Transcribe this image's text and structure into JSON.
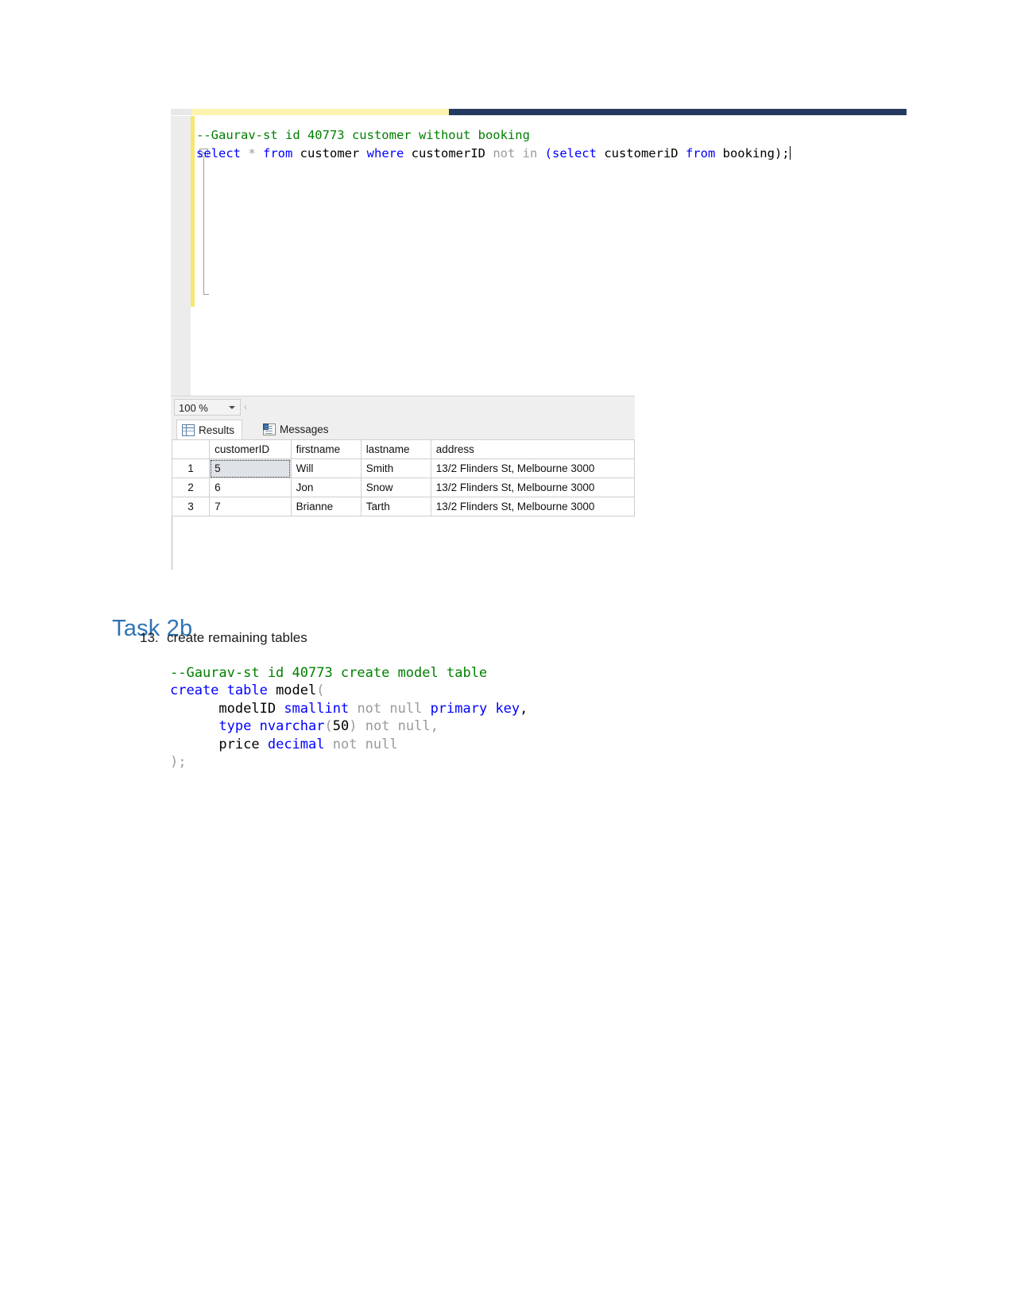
{
  "ssms": {
    "editor": {
      "line1": {
        "comment": "--Gaurav-st id 40773 customer without booking"
      },
      "line2": {
        "kw_select": "select",
        "star": " * ",
        "kw_from": "from",
        "tbl_customer": " customer ",
        "kw_where": "where",
        "col_customerid": " customerID ",
        "kw_not_in": "not in",
        "paren_open": " (",
        "kw_select2": "select",
        "col_customerid2": " customeriD ",
        "kw_from2": "from",
        "tbl_booking": " booking);"
      }
    },
    "zoom": {
      "level": "100 %",
      "splitter_glyph": "‹"
    },
    "tabs": [
      {
        "label": "Results",
        "icon": "grid-icon",
        "active": true
      },
      {
        "label": "Messages",
        "icon": "messages-icon",
        "active": false
      }
    ],
    "grid": {
      "columns": [
        "",
        "customerID",
        "firstname",
        "lastname",
        "address"
      ],
      "rows": [
        {
          "n": "1",
          "customerID": "5",
          "firstname": "Will",
          "lastname": "Smith",
          "address": "13/2 Flinders St, Melbourne 3000"
        },
        {
          "n": "2",
          "customerID": "6",
          "firstname": "Jon",
          "lastname": "Snow",
          "address": "13/2 Flinders St, Melbourne 3000"
        },
        {
          "n": "3",
          "customerID": "7",
          "firstname": "Brianne",
          "lastname": "Tarth",
          "address": "13/2 Flinders St, Melbourne 3000"
        }
      ],
      "selected_cell": {
        "row": 0,
        "column": "customerID"
      }
    }
  },
  "document": {
    "heading": "Task 2b",
    "list_item": {
      "number": "13.",
      "text": "create remaining tables"
    },
    "code": {
      "l1_comment": "--Gaurav-st id 40773 create model table",
      "l2_create": "create table",
      "l2_name": " model",
      "l2_paren": "(",
      "l3_indent": "      ",
      "l3_col": "modelID ",
      "l3_type": "smallint",
      "l3_notnull": " not null ",
      "l3_pk": "primary key",
      "l3_comma": ",",
      "l4_indent": "      ",
      "l4_col": "type",
      "l4_type": " nvarchar",
      "l4_paren_open": "(",
      "l4_len": "50",
      "l4_paren_close": ")",
      "l4_notnull": " not null,",
      "l5_indent": "      ",
      "l5_col": "price ",
      "l5_type": "decimal",
      "l5_notnull": " not null",
      "l6_close": ");"
    }
  },
  "colors": {
    "heading_blue": "#2e74b5",
    "sql_keyword": "#0000ff",
    "sql_type": "#2b91af",
    "sql_comment": "#008000",
    "sql_grey": "#9a9a9a",
    "change_bar_yellow": "#f5e76f",
    "title_bar_navy": "#243a5e"
  }
}
